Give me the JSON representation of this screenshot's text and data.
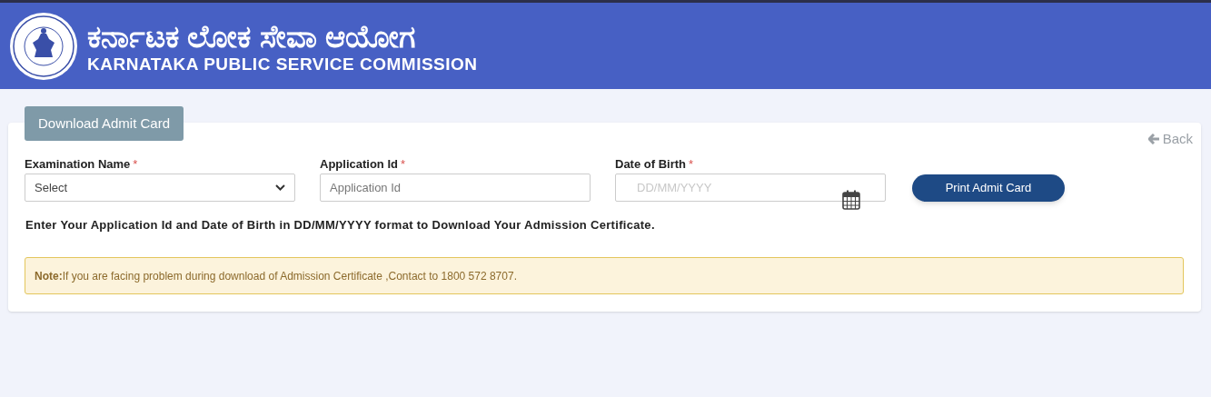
{
  "header": {
    "title_kannada": "ಕರ್ನಾಟಕ ಲೋಕ ಸೇವಾ ಆಯೋಗ",
    "title": "KARNATAKA PUBLIC SERVICE COMMISSION"
  },
  "tab": {
    "label": "Download Admit Card"
  },
  "back_link": "Back",
  "fields": [
    {
      "kind": "select",
      "label": "Examination Name",
      "required_mark": "*",
      "value": "Select"
    },
    {
      "kind": "text",
      "label": "Application Id",
      "required_mark": "*",
      "placeholder": "Application Id"
    },
    {
      "kind": "date",
      "label": "Date of Birth",
      "required_mark": "*",
      "placeholder": "DD/MM/YYYY"
    }
  ],
  "print_button": "Print Admit Card",
  "instruction": "Enter Your Application Id and Date of Birth in DD/MM/YYYY format to Download Your Admission Certificate.",
  "note": "**Note:**If you are facing problem during download of Admission Certificate ,Contact to 1800 572 8707."
}
